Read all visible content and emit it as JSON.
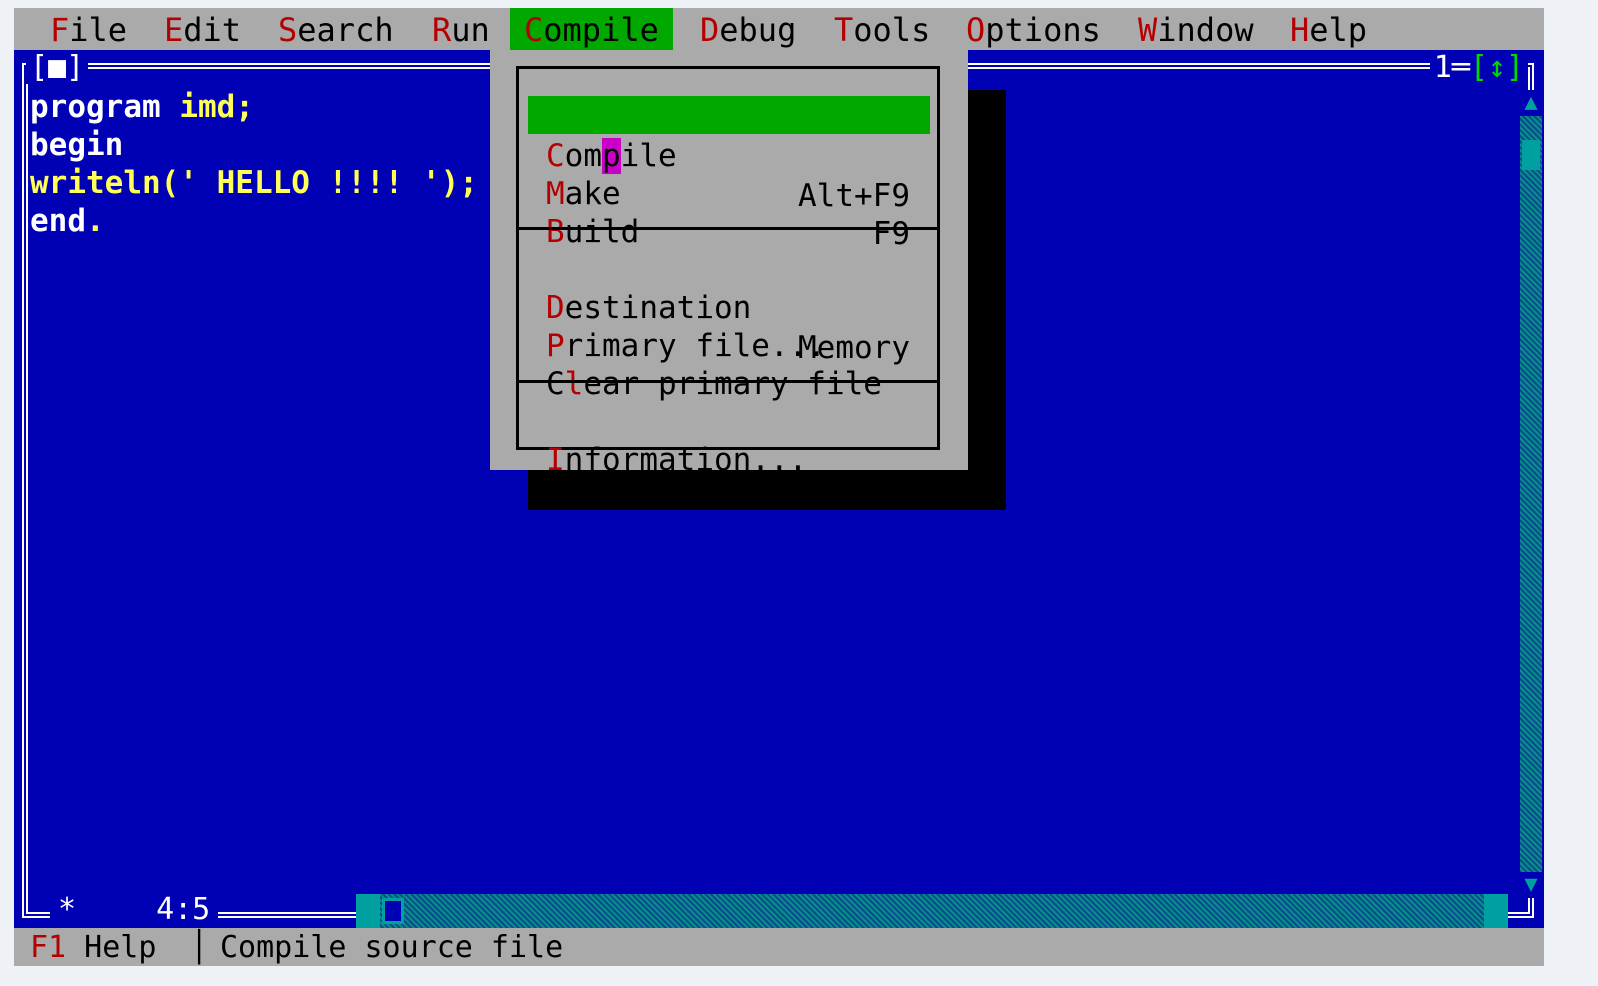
{
  "menubar": {
    "items": [
      {
        "hot": "F",
        "rest": "ile"
      },
      {
        "hot": "E",
        "rest": "dit"
      },
      {
        "hot": "S",
        "rest": "earch"
      },
      {
        "hot": "R",
        "rest": "un"
      },
      {
        "hot": "C",
        "rest": "ompile"
      },
      {
        "hot": "D",
        "rest": "ebug"
      },
      {
        "hot": "T",
        "rest": "ools"
      },
      {
        "hot": "O",
        "rest": "ptions"
      },
      {
        "hot": "W",
        "rest": "indow"
      },
      {
        "hot": "H",
        "rest": "elp"
      }
    ],
    "active": "Compile"
  },
  "window": {
    "close_box": "[■]",
    "number": "1",
    "zoom_box": "[↕]"
  },
  "editor": {
    "lines": [
      {
        "kw": "program",
        "rest": " imd;"
      },
      {
        "kw": "begin",
        "rest": ""
      },
      {
        "kw": "",
        "rest": "writeln(' HELLO !!!! ');"
      },
      {
        "kw": "end",
        "rest": "."
      }
    ],
    "cursor_position": "4:5"
  },
  "compile_menu": {
    "items": [
      {
        "hot": "C",
        "rest_pre": "om",
        "cursor_char": "p",
        "rest_post": "ile",
        "shortcut": "Alt+F9",
        "selected": true
      },
      {
        "hot": "M",
        "rest": "ake",
        "shortcut": "F9"
      },
      {
        "hot": "B",
        "rest": "uild",
        "shortcut": ""
      },
      {
        "hot": "D",
        "rest": "estination",
        "shortcut": "Memory"
      },
      {
        "hot": "P",
        "rest": "rimary file...",
        "shortcut": ""
      },
      {
        "pre": "C",
        "hot": "l",
        "rest": "ear primary file",
        "shortcut": ""
      },
      {
        "hot": "I",
        "rest": "nformation...",
        "shortcut": ""
      }
    ]
  },
  "statusbar": {
    "key": "F1",
    "key_label": " Help",
    "separator": "│",
    "hint": "Compile source file"
  },
  "colors": {
    "desktop_blue": "#0000b4",
    "menu_gray": "#aaaaaa",
    "highlight_green": "#00a800",
    "hotkey_red": "#b40000",
    "code_yellow": "#ffff55"
  }
}
